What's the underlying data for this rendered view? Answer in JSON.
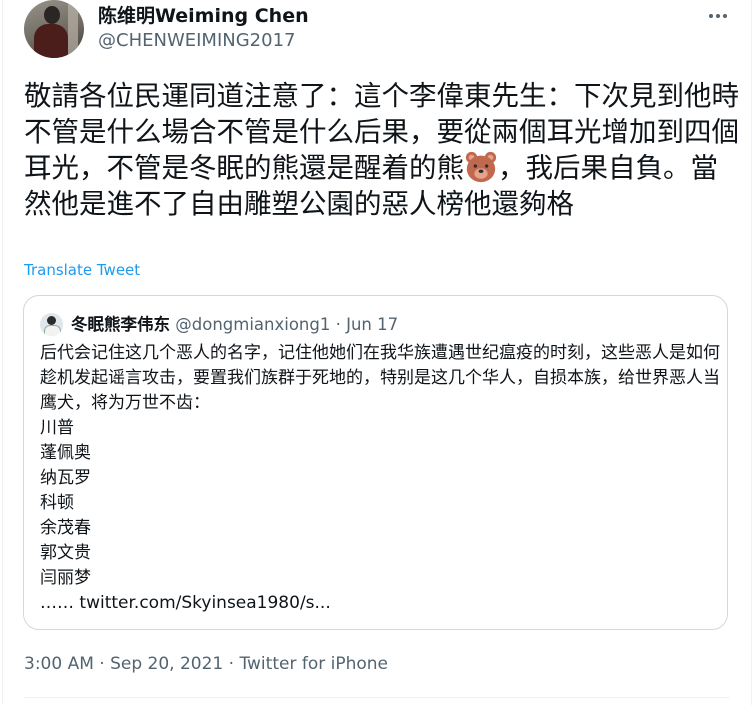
{
  "author": {
    "display_name": "陈维明Weiming Chen",
    "handle": "@CHENWEIMING2017"
  },
  "tweet": {
    "text_before_emoji": "敬請各位民運同道注意了：這个李偉東先生：下次見到他時不管是什么場合不管是什么后果，要從兩個耳光增加到四個耳光，不管是冬眠的熊還是醒着的熊",
    "emoji": "bear-face-icon",
    "text_after_emoji": "，我后果自負。當然他是進不了自由雕塑公園的惡人榜他還夠格",
    "translate_label": "Translate Tweet",
    "timestamp": "3:00 AM · Sep 20, 2021 · ",
    "source": "Twitter for iPhone"
  },
  "quoted_tweet": {
    "display_name": "冬眠熊李伟东",
    "handle": "@dongmianxiong1",
    "date": " · Jun 17",
    "paragraph": "后代会记住这几个恶人的名字，记住他她们在我华族遭遇世纪瘟疫的时刻，这些恶人是如何趁机发起谣言攻击，要置我们族群于死地的，特别是这几个华人，自损本族，给世界恶人当鹰犬，将为万世不齿：",
    "names": [
      "川普",
      "蓬佩奥",
      "纳瓦罗",
      "科顿",
      "余茂春",
      "郭文贵",
      "闫丽梦"
    ],
    "link_line": "…… twitter.com/Skyinsea1980/s..."
  },
  "colors": {
    "text": "#0f1419",
    "secondary": "#536471",
    "accent": "#1d9bf0",
    "border": "#cfd9de"
  }
}
